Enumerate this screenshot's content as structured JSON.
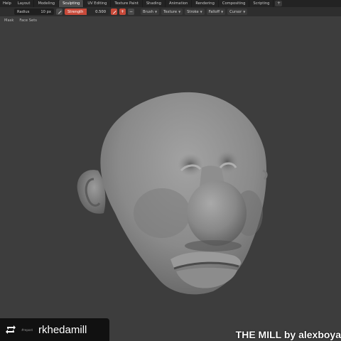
{
  "topbar": {
    "menu": "Help",
    "tabs": [
      "Layout",
      "Modeling",
      "Sculpting",
      "UV Editing",
      "Texture Paint",
      "Shading",
      "Animation",
      "Rendering",
      "Compositing",
      "Scripting"
    ],
    "active_tab": "Sculpting",
    "add_tab": "+"
  },
  "toolbar": {
    "radius_label": "Radius",
    "radius_value": "10 px",
    "strength_label": "Strength",
    "strength_value": "0.500",
    "strength_level": 0.5,
    "plus": "+",
    "minus": "−",
    "dropdowns": [
      "Brush",
      "Texture",
      "Stroke",
      "Falloff",
      "Cursor"
    ]
  },
  "subbar": {
    "mask": "Mask",
    "face_sets": "Face Sets"
  },
  "overlay": {
    "repost_caption": "#repost",
    "repost_user": "rkhedamill",
    "credit": "THE MILL by alexboya"
  },
  "colors": {
    "background": "#3d3d3d",
    "accent": "#c84a3a",
    "sculpt": "#8a8a8a"
  }
}
